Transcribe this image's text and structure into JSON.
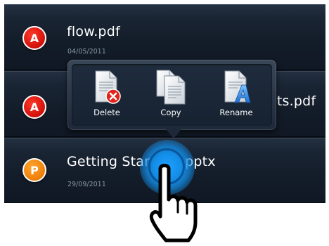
{
  "files": [
    {
      "name": "flow.pdf",
      "date": "04/05/2011",
      "icon_letter": "A",
      "icon": "pdf-icon",
      "icon_color": "#e0150f"
    },
    {
      "name": "ets.pdf",
      "date": "",
      "icon_letter": "A",
      "icon": "pdf-icon",
      "icon_color": "#e0150f"
    },
    {
      "name": "Getting Star",
      "name_tail": "pptx",
      "date": "29/09/2011",
      "icon_letter": "P",
      "icon": "powerpoint-icon",
      "icon_color": "#ee7e05"
    }
  ],
  "context_menu": {
    "items": [
      {
        "label": "Delete",
        "icon": "delete-document-icon"
      },
      {
        "label": "Copy",
        "icon": "copy-document-icon"
      },
      {
        "label": "Rename",
        "icon": "rename-document-icon"
      }
    ]
  },
  "touch": {
    "gesture": "long-press",
    "icon": "hand-pointer-icon",
    "color": "#138ee8"
  }
}
